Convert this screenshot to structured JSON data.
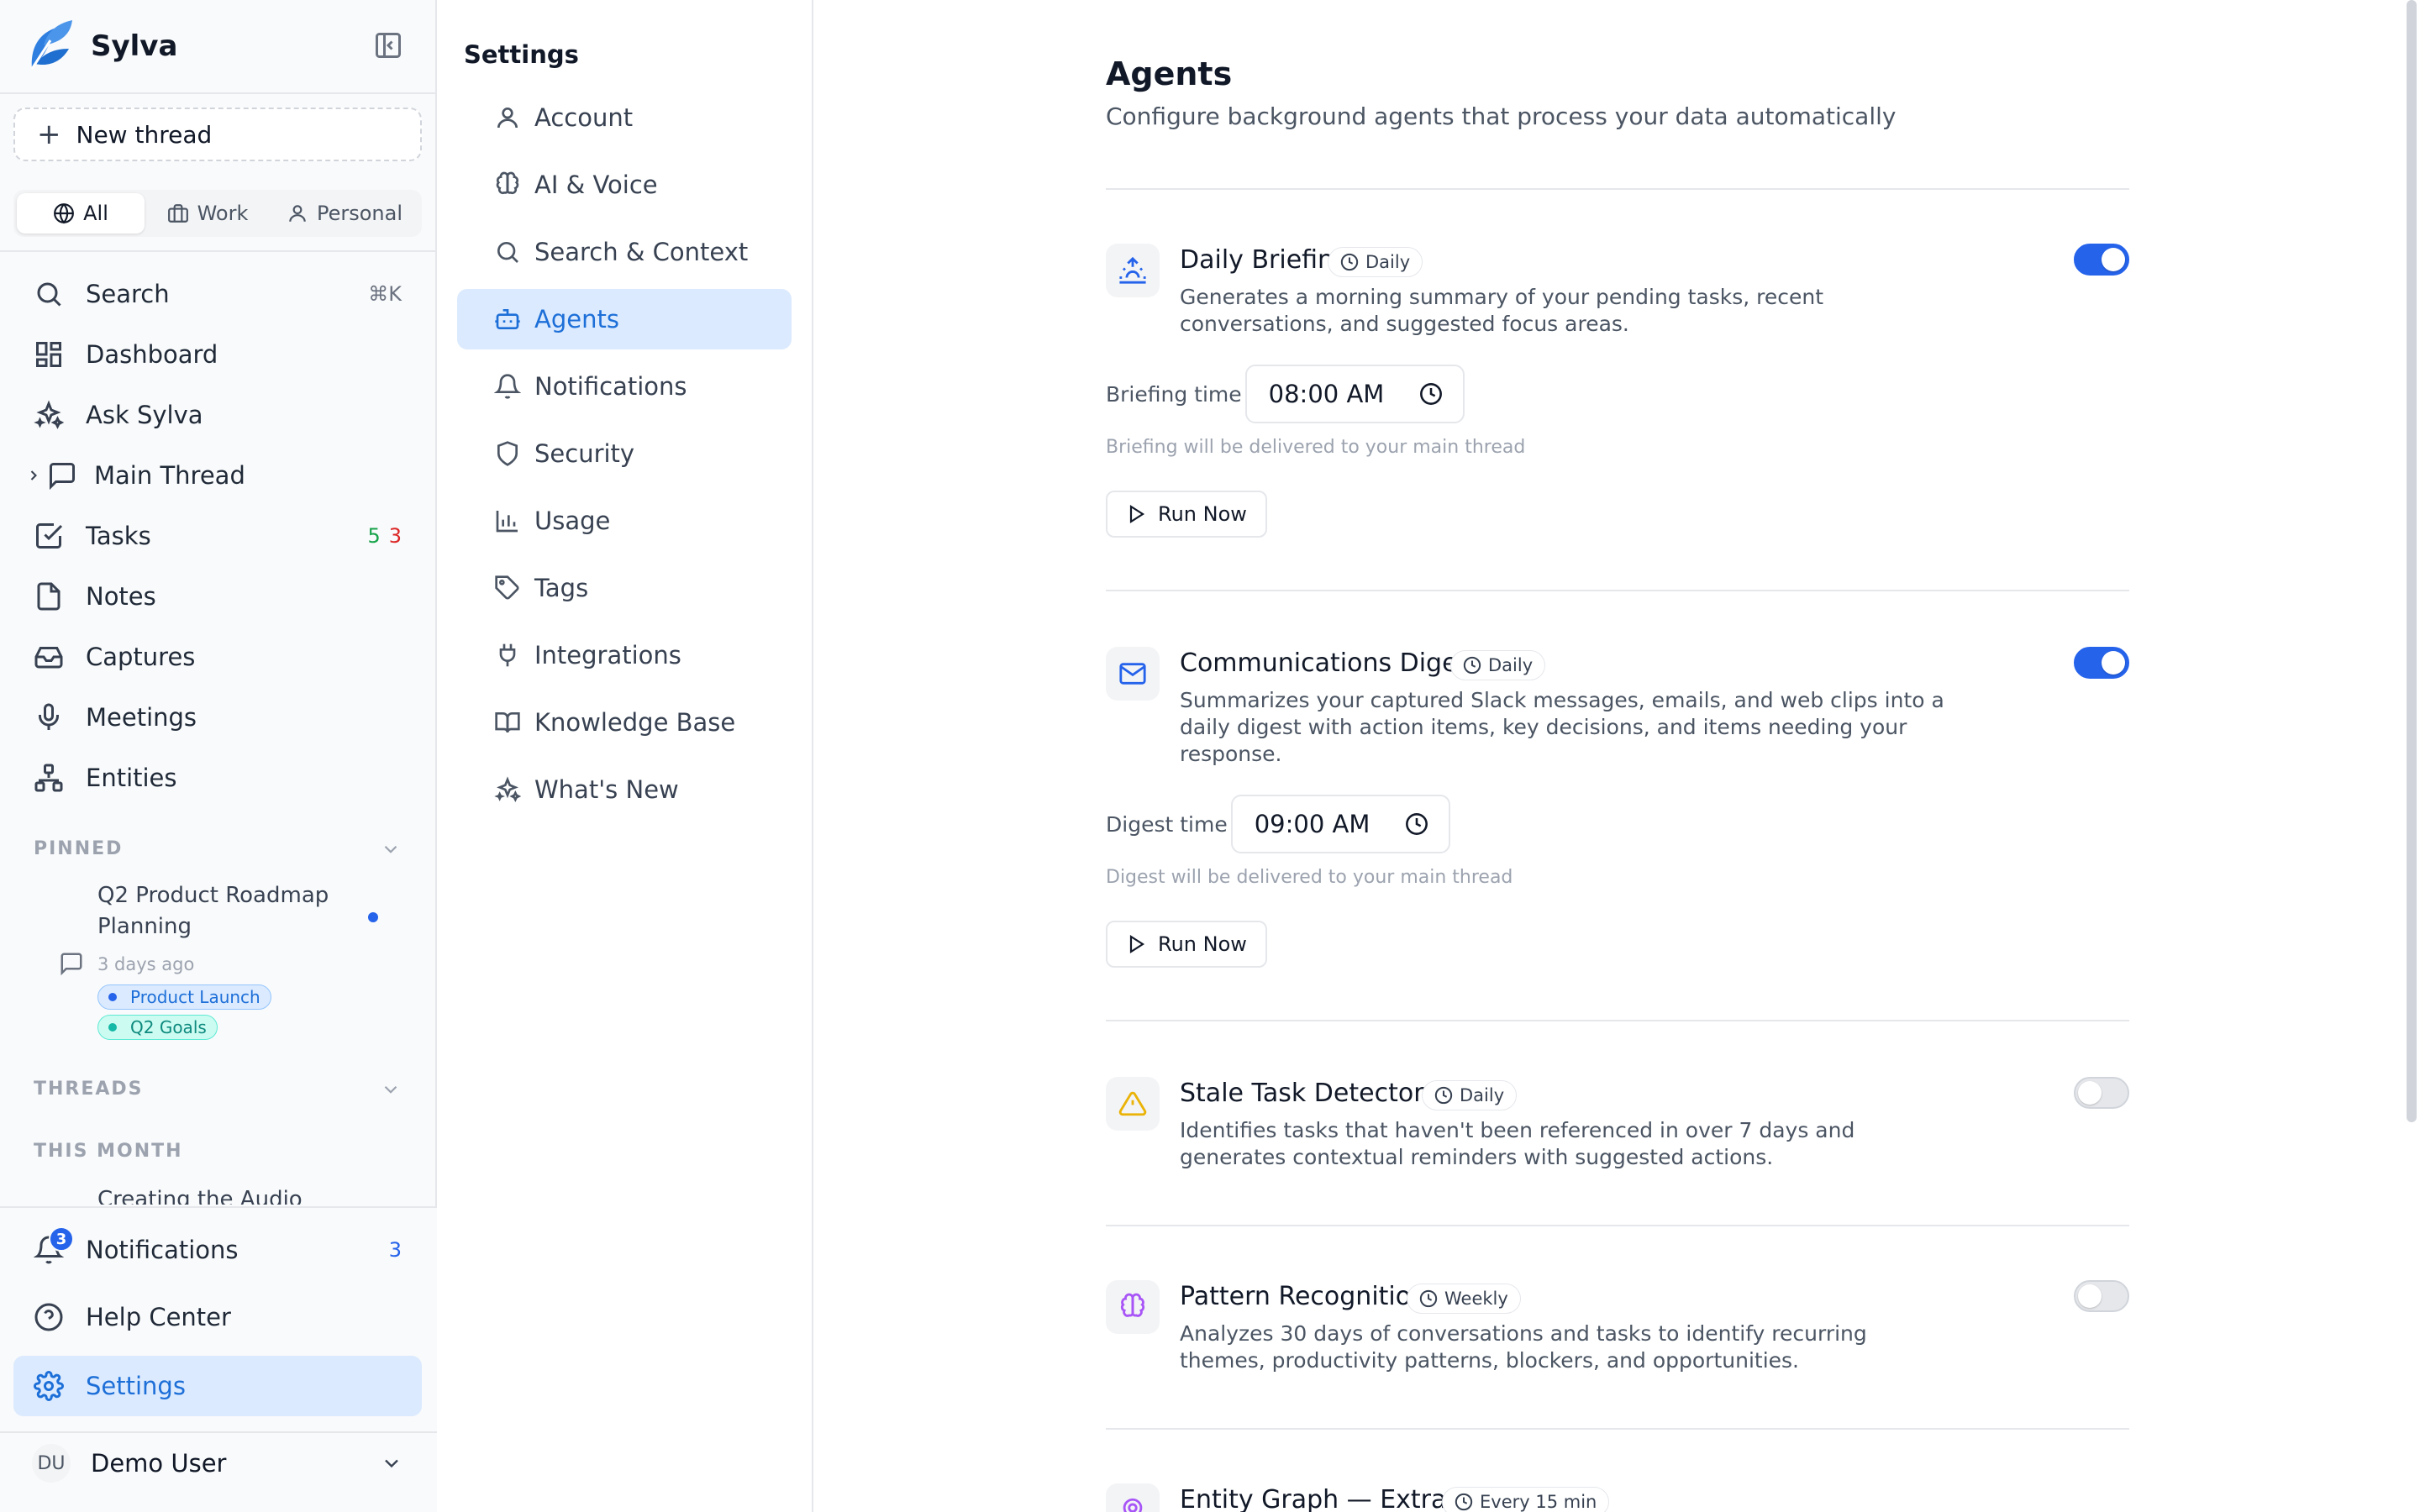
{
  "app": {
    "name": "Sylva"
  },
  "sidebar": {
    "new_thread": "New thread",
    "scopes": [
      "All",
      "Work",
      "Personal"
    ],
    "nav": {
      "search": {
        "label": "Search",
        "shortcut": "⌘K"
      },
      "dashboard": {
        "label": "Dashboard"
      },
      "ask": {
        "label": "Ask Sylva"
      },
      "main_thread": {
        "label": "Main Thread"
      },
      "tasks": {
        "label": "Tasks",
        "count_green": "5",
        "count_red": "3"
      },
      "notes": {
        "label": "Notes"
      },
      "captures": {
        "label": "Captures"
      },
      "meetings": {
        "label": "Meetings"
      },
      "entities": {
        "label": "Entities"
      }
    },
    "pinned_label": "PINNED",
    "pinned_thread": {
      "title": "Q2 Product Roadmap Planning",
      "time": "3 days ago",
      "tags": [
        "Product Launch",
        "Q2 Goals"
      ]
    },
    "threads_label": "THREADS",
    "this_month_label": "THIS MONTH",
    "clipped_thread": "Creating the Audio",
    "bottom": {
      "notifications": {
        "label": "Notifications",
        "badge": "3",
        "count": "3"
      },
      "help": {
        "label": "Help Center"
      },
      "settings": {
        "label": "Settings"
      }
    },
    "user": {
      "initials": "DU",
      "name": "Demo User"
    }
  },
  "settings_nav": {
    "title": "Settings",
    "items": [
      "Account",
      "AI & Voice",
      "Search & Context",
      "Agents",
      "Notifications",
      "Security",
      "Usage",
      "Tags",
      "Integrations",
      "Knowledge Base",
      "What's New"
    ],
    "active": "Agents"
  },
  "main": {
    "title": "Agents",
    "subtitle": "Configure background agents that process your data automatically",
    "agents": [
      {
        "name": "Daily Briefing",
        "frequency": "Daily",
        "description": "Generates a morning summary of your pending tasks, recent conversations, and suggested focus areas.",
        "enabled": true,
        "time_label": "Briefing time",
        "time_value": "08:00 AM",
        "hint": "Briefing will be delivered to your main thread",
        "run_label": "Run Now"
      },
      {
        "name": "Communications Digest",
        "frequency": "Daily",
        "description": "Summarizes your captured Slack messages, emails, and web clips into a daily digest with action items, key decisions, and items needing your response.",
        "enabled": true,
        "time_label": "Digest time",
        "time_value": "09:00 AM",
        "hint": "Digest will be delivered to your main thread",
        "run_label": "Run Now"
      },
      {
        "name": "Stale Task Detector",
        "frequency": "Daily",
        "description": "Identifies tasks that haven't been referenced in over 7 days and generates contextual reminders with suggested actions.",
        "enabled": false
      },
      {
        "name": "Pattern Recognition",
        "frequency": "Weekly",
        "description": "Analyzes 30 days of conversations and tasks to identify recurring themes, productivity patterns, blockers, and opportunities.",
        "enabled": false
      },
      {
        "name": "Entity Graph — Extract",
        "frequency": "Every 15 min"
      }
    ]
  },
  "colors": {
    "accent": "#2563eb",
    "active_bg": "#dbeafe",
    "warning": "#eab308",
    "purple": "#a855f7"
  }
}
